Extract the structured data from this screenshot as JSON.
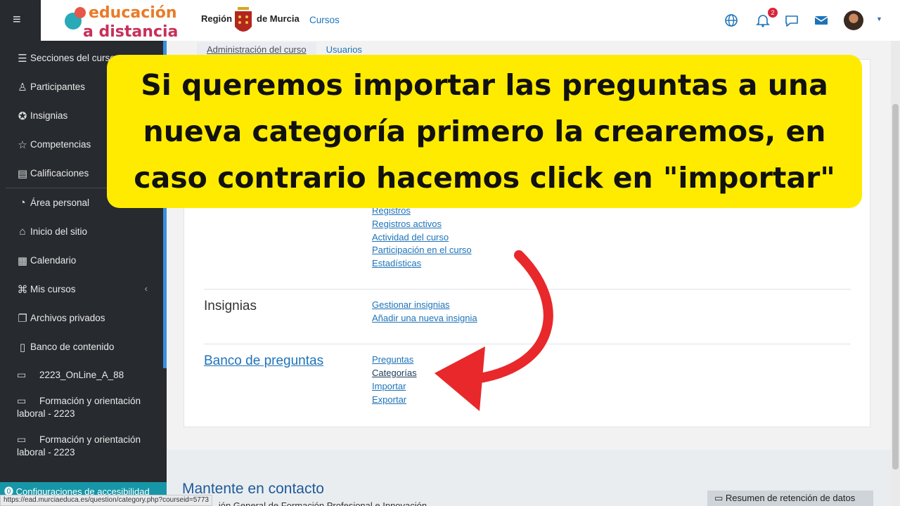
{
  "header": {
    "logo_line1": "educación",
    "logo_line2": "a distancia",
    "region_left": "Región",
    "region_right": "de Murcia",
    "cursos": "Cursos",
    "notifications_count": "2"
  },
  "sidebar": {
    "items": [
      {
        "label": "Secciones del curso",
        "icon": "list-icon"
      },
      {
        "label": "Participantes",
        "icon": "users-icon"
      },
      {
        "label": "Insignias",
        "icon": "badge-icon"
      },
      {
        "label": "Competencias",
        "icon": "star-icon"
      },
      {
        "label": "Calificaciones",
        "icon": "table-icon"
      },
      {
        "label": "Área personal",
        "icon": "dashboard-icon"
      },
      {
        "label": "Inicio del sitio",
        "icon": "home-icon"
      },
      {
        "label": "Calendario",
        "icon": "calendar-icon"
      },
      {
        "label": "Mis cursos",
        "icon": "graduation-icon"
      },
      {
        "label": "Archivos privados",
        "icon": "files-icon"
      },
      {
        "label": "Banco de contenido",
        "icon": "clipboard-icon"
      }
    ],
    "courses": [
      {
        "label": "2223_OnLine_A_88"
      },
      {
        "label": "Formación y orientación laboral - 2223"
      },
      {
        "label": "Formación y orientación laboral - 2223"
      }
    ],
    "accessibility": "Configuraciones de accesibilidad"
  },
  "statusbar": "https://ead.murciaeduca.es/question/category.php?courseid=5773",
  "tabs": [
    "Administración del curso",
    "Usuarios"
  ],
  "reports_links": [
    "Registros",
    "Registros activos",
    "Actividad del curso",
    "Participación en el curso",
    "Estadísticas"
  ],
  "badges_section": {
    "title": "Insignias",
    "links": [
      "Gestionar insignias",
      "Añadir una nueva insignia"
    ]
  },
  "question_bank": {
    "title": "Banco de preguntas",
    "links": [
      "Preguntas",
      "Categorías",
      "Importar",
      "Exportar"
    ]
  },
  "footer": {
    "title": "Mantente en contacto",
    "subtitle": "...ión General de Formación Profesional e Innovación",
    "data_retention": "Resumen de retención de datos"
  },
  "callout": {
    "text": "Si queremos importar las preguntas a una nueva categoría primero la crearemos, en caso contrario hacemos click en \"importar\""
  },
  "colors": {
    "sidebar": "#272a2f",
    "link": "#1e73b8",
    "callout": "#ffeb00",
    "arrow": "#e8282b"
  }
}
